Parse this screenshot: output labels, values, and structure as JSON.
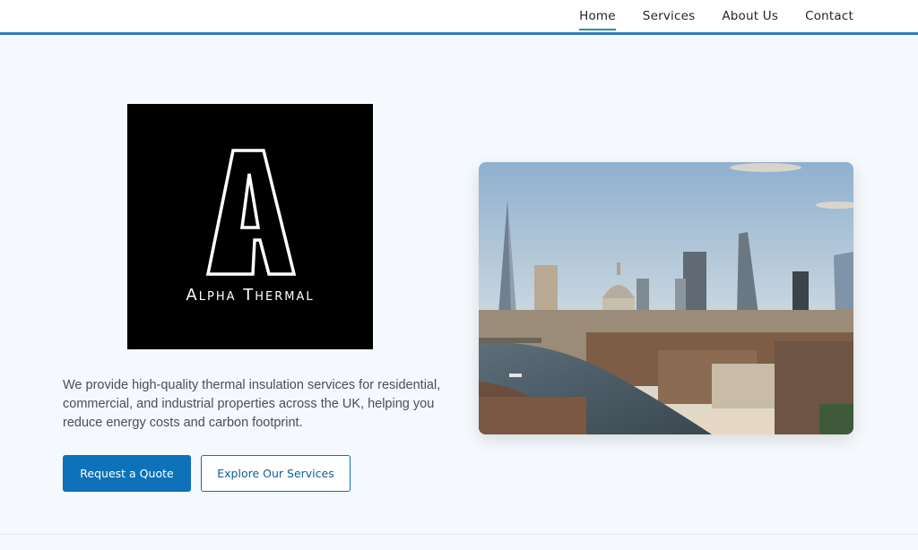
{
  "nav": {
    "items": [
      "Home",
      "Services",
      "About Us",
      "Contact"
    ],
    "active": "Home"
  },
  "logo": {
    "text": "Alpha Thermal"
  },
  "hero": {
    "description": "We provide high-quality thermal insulation services for residential, commercial, and industrial properties across the UK, helping you reduce energy costs and carbon footprint.",
    "primary_button": "Request a Quote",
    "secondary_button": "Explore Our Services"
  },
  "colors": {
    "accent": "#0d72b9",
    "nav_underline": "#2f8fa6",
    "header_border": "#2f7bbf",
    "page_bg": "#f5f8fc"
  }
}
